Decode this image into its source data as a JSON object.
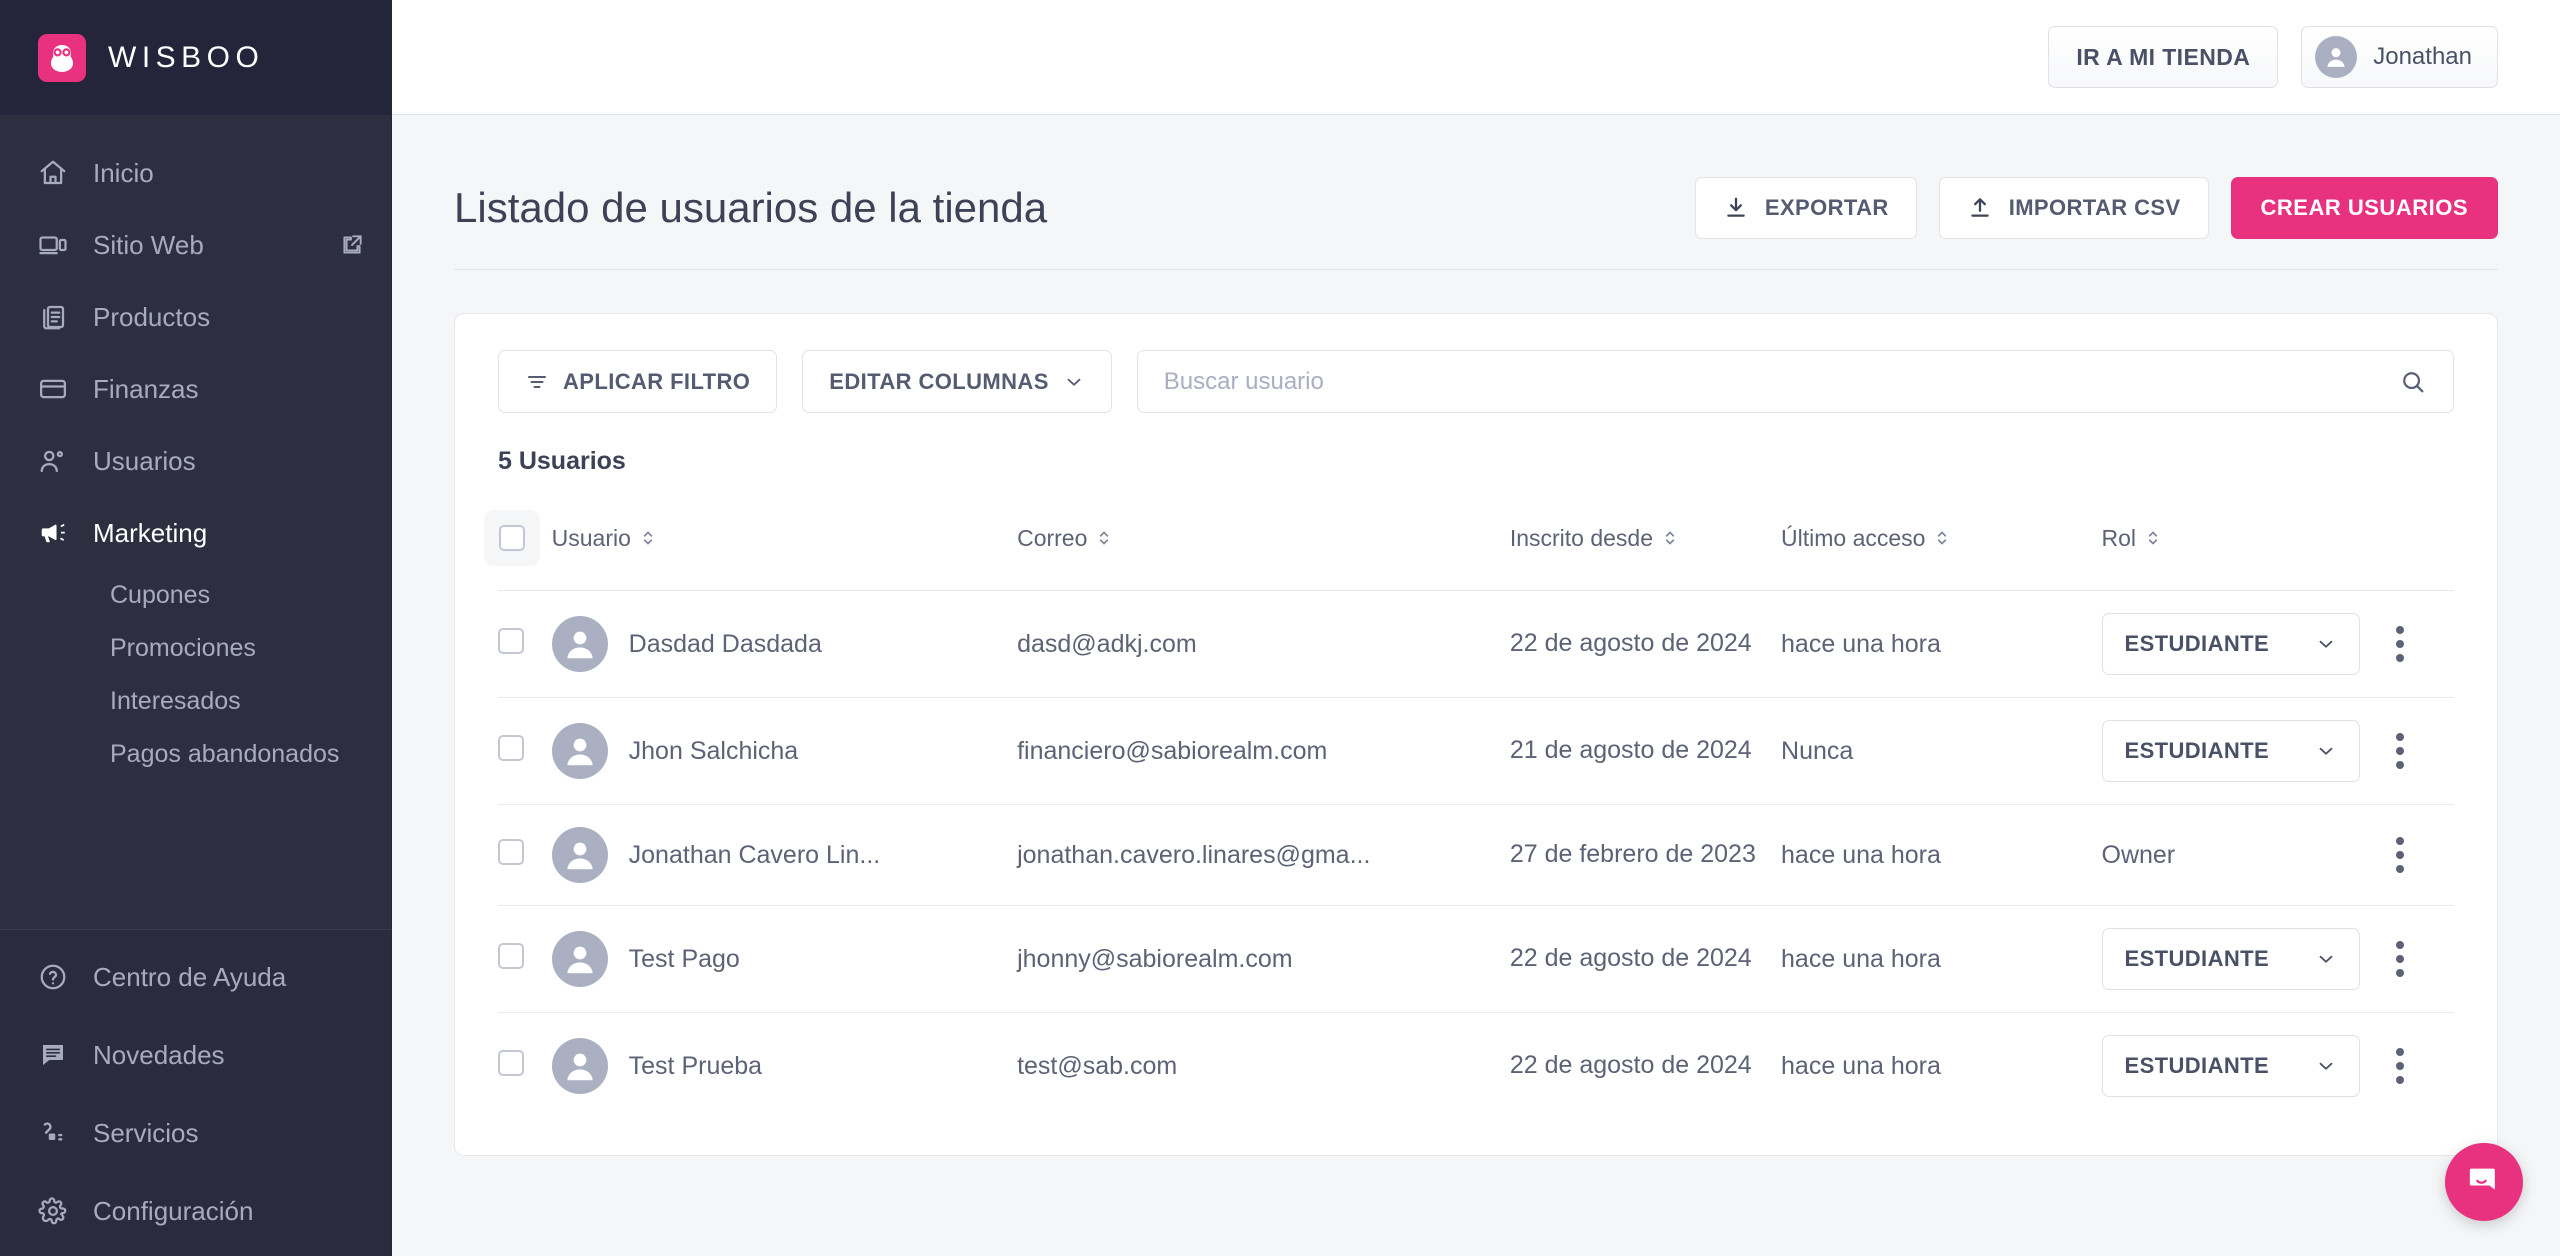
{
  "brand": {
    "name": "WISBOO",
    "logo_icon": "owl-icon",
    "accent": "#e8317f"
  },
  "sidebar": {
    "items": [
      {
        "label": "Inicio",
        "icon": "home-icon"
      },
      {
        "label": "Sitio Web",
        "icon": "monitor-icon",
        "external": true
      },
      {
        "label": "Productos",
        "icon": "book-icon"
      },
      {
        "label": "Finanzas",
        "icon": "credit-card-icon"
      },
      {
        "label": "Usuarios",
        "icon": "users-icon"
      },
      {
        "label": "Marketing",
        "icon": "megaphone-icon",
        "active": true
      }
    ],
    "sub_items": [
      {
        "label": "Cupones"
      },
      {
        "label": "Promociones"
      },
      {
        "label": "Interesados"
      },
      {
        "label": "Pagos abandonados"
      }
    ],
    "footer_items": [
      {
        "label": "Centro de Ayuda",
        "icon": "help-circle-icon"
      },
      {
        "label": "Novedades",
        "icon": "message-square-icon"
      },
      {
        "label": "Servicios",
        "icon": "plug-icon"
      },
      {
        "label": "Configuración",
        "icon": "gear-icon"
      }
    ]
  },
  "topbar": {
    "store_button": "IR A MI TIENDA",
    "user_name": "Jonathan"
  },
  "page": {
    "title": "Listado de usuarios de la tienda",
    "actions": {
      "export": "EXPORTAR",
      "import": "IMPORTAR CSV",
      "create": "CREAR USUARIOS"
    }
  },
  "toolbar": {
    "filter_button": "APLICAR FILTRO",
    "columns_button": "EDITAR COLUMNAS",
    "search_placeholder": "Buscar usuario",
    "search_value": ""
  },
  "table": {
    "count_label": "5 Usuarios",
    "columns": [
      {
        "label": "Usuario",
        "sortable": true
      },
      {
        "label": "Correo",
        "sortable": true
      },
      {
        "label": "Inscrito desde",
        "sortable": true
      },
      {
        "label": "Último acceso",
        "sortable": true
      },
      {
        "label": "Rol",
        "sortable": true
      }
    ],
    "rows": [
      {
        "name": "Dasdad Dasdada",
        "email": "dasd@adkj.com",
        "since": "22 de agosto de 2024",
        "last_access": "hace una hora",
        "role": "ESTUDIANTE",
        "role_editable": true
      },
      {
        "name": "Jhon Salchicha",
        "email": "financiero@sabiorealm.com",
        "since": "21 de agosto de 2024",
        "last_access": "Nunca",
        "role": "ESTUDIANTE",
        "role_editable": true
      },
      {
        "name": "Jonathan Cavero Lin...",
        "email": "jonathan.cavero.linares@gma...",
        "since": "27 de febrero de 2023",
        "last_access": "hace una hora",
        "role": "Owner",
        "role_editable": false
      },
      {
        "name": "Test Pago",
        "email": "jhonny@sabiorealm.com",
        "since": "22 de agosto de 2024",
        "last_access": "hace una hora",
        "role": "ESTUDIANTE",
        "role_editable": true
      },
      {
        "name": "Test Prueba",
        "email": "test@sab.com",
        "since": "22 de agosto de 2024",
        "last_access": "hace una hora",
        "role": "ESTUDIANTE",
        "role_editable": true
      }
    ]
  },
  "chat": {
    "icon": "chat-bubble-icon"
  }
}
